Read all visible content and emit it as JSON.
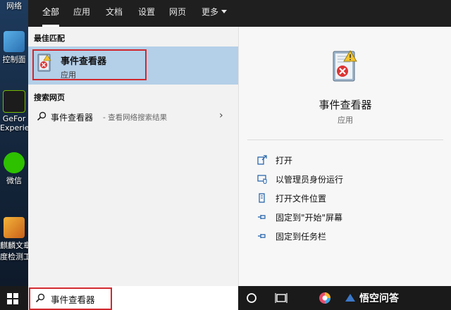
{
  "desktop": {
    "icons": [
      {
        "label": "网络"
      },
      {
        "label": "控制面"
      },
      {
        "label": "GeFor"
      },
      {
        "label": "Experie"
      },
      {
        "label": "微信"
      },
      {
        "label": "麒麟文章"
      },
      {
        "label": "度检测工"
      }
    ]
  },
  "start_menu": {
    "tabs": [
      {
        "label": "全部",
        "active": true
      },
      {
        "label": "应用"
      },
      {
        "label": "文档"
      },
      {
        "label": "设置"
      },
      {
        "label": "网页"
      },
      {
        "label": "更多"
      }
    ],
    "best_match": {
      "heading": "最佳匹配",
      "title": "事件查看器",
      "type": "应用"
    },
    "web_search": {
      "heading": "搜索网页",
      "term": "事件查看器",
      "suffix": "- 查看网络搜索结果"
    },
    "detail": {
      "title": "事件查看器",
      "type": "应用",
      "actions": [
        {
          "label": "打开",
          "icon": "open-icon"
        },
        {
          "label": "以管理员身份运行",
          "icon": "shield-admin-icon"
        },
        {
          "label": "打开文件位置",
          "icon": "file-location-icon"
        },
        {
          "label": "固定到\"开始\"屏幕",
          "icon": "pin-icon"
        },
        {
          "label": "固定到任务栏",
          "icon": "pin-icon"
        }
      ]
    }
  },
  "taskbar": {
    "search_value": "事件查看器",
    "watermark": "悟空问答"
  },
  "colors": {
    "highlight_row": "#b4cfe8",
    "annotation_border": "#d0282e",
    "tab_bar": "#1f1f1f",
    "taskbar": "#1a1a1a"
  }
}
